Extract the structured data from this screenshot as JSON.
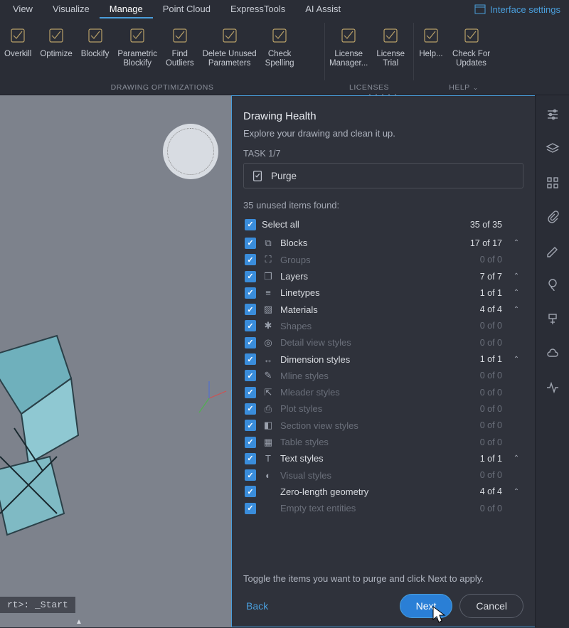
{
  "menu": {
    "tabs": [
      "View",
      "Visualize",
      "Manage",
      "Point Cloud",
      "ExpressTools",
      "AI Assist"
    ],
    "active_index": 2,
    "interface_settings": "Interface settings"
  },
  "ribbon": {
    "groups": [
      {
        "label": "DRAWING OPTIMIZATIONS",
        "buttons": [
          {
            "label1": "Overkill",
            "label2": ""
          },
          {
            "label1": "Optimize",
            "label2": ""
          },
          {
            "label1": "Blockify",
            "label2": ""
          },
          {
            "label1": "Parametric",
            "label2": "Blockify"
          },
          {
            "label1": "Find",
            "label2": "Outliers"
          },
          {
            "label1": "Delete Unused",
            "label2": "Parameters"
          },
          {
            "label1": "Check",
            "label2": "Spelling"
          }
        ]
      },
      {
        "label": "LICENSES",
        "buttons": [
          {
            "label1": "License",
            "label2": "Manager..."
          },
          {
            "label1": "License",
            "label2": "Trial"
          }
        ]
      },
      {
        "label": "HELP",
        "buttons": [
          {
            "label1": "Help...",
            "label2": ""
          },
          {
            "label1": "Check For",
            "label2": "Updates"
          }
        ]
      }
    ]
  },
  "panel": {
    "title": "Drawing Health",
    "subtitle": "Explore your drawing and clean it up.",
    "task_label": "TASK 1/7",
    "task_name": "Purge",
    "found_label": "35 unused items found:",
    "select_all": {
      "label": "Select all",
      "count": "35 of 35"
    },
    "items": [
      {
        "label": "Blocks",
        "count": "17 of 17",
        "dim": false,
        "expand": true,
        "glyph": "⧉"
      },
      {
        "label": "Groups",
        "count": "0 of 0",
        "dim": true,
        "expand": false,
        "glyph": "⛶"
      },
      {
        "label": "Layers",
        "count": "7 of 7",
        "dim": false,
        "expand": true,
        "glyph": "❒"
      },
      {
        "label": "Linetypes",
        "count": "1 of 1",
        "dim": false,
        "expand": true,
        "glyph": "≡"
      },
      {
        "label": "Materials",
        "count": "4 of 4",
        "dim": false,
        "expand": true,
        "glyph": "▨"
      },
      {
        "label": "Shapes",
        "count": "0 of 0",
        "dim": true,
        "expand": false,
        "glyph": "✱"
      },
      {
        "label": "Detail view styles",
        "count": "0 of 0",
        "dim": true,
        "expand": false,
        "glyph": "◎"
      },
      {
        "label": "Dimension styles",
        "count": "1 of 1",
        "dim": false,
        "expand": true,
        "glyph": "↔"
      },
      {
        "label": "Mline styles",
        "count": "0 of 0",
        "dim": true,
        "expand": false,
        "glyph": "✎"
      },
      {
        "label": "Mleader styles",
        "count": "0 of 0",
        "dim": true,
        "expand": false,
        "glyph": "⇱"
      },
      {
        "label": "Plot styles",
        "count": "0 of 0",
        "dim": true,
        "expand": false,
        "glyph": "⎙"
      },
      {
        "label": "Section view styles",
        "count": "0 of 0",
        "dim": true,
        "expand": false,
        "glyph": "◧"
      },
      {
        "label": "Table styles",
        "count": "0 of 0",
        "dim": true,
        "expand": false,
        "glyph": "▦"
      },
      {
        "label": "Text styles",
        "count": "1 of 1",
        "dim": false,
        "expand": true,
        "glyph": "T"
      },
      {
        "label": "Visual styles",
        "count": "0 of 0",
        "dim": true,
        "expand": false,
        "glyph": "◐"
      },
      {
        "label": "Zero-length geometry",
        "count": "4 of 4",
        "dim": false,
        "expand": true,
        "glyph": ""
      },
      {
        "label": "Empty text entities",
        "count": "0 of 0",
        "dim": true,
        "expand": false,
        "glyph": ""
      }
    ],
    "hint": "Toggle the items you want to purge and click Next to apply.",
    "buttons": {
      "back": "Back",
      "next": "Next",
      "cancel": "Cancel"
    }
  },
  "canvas": {
    "cmdline": "rt>: _Start"
  }
}
